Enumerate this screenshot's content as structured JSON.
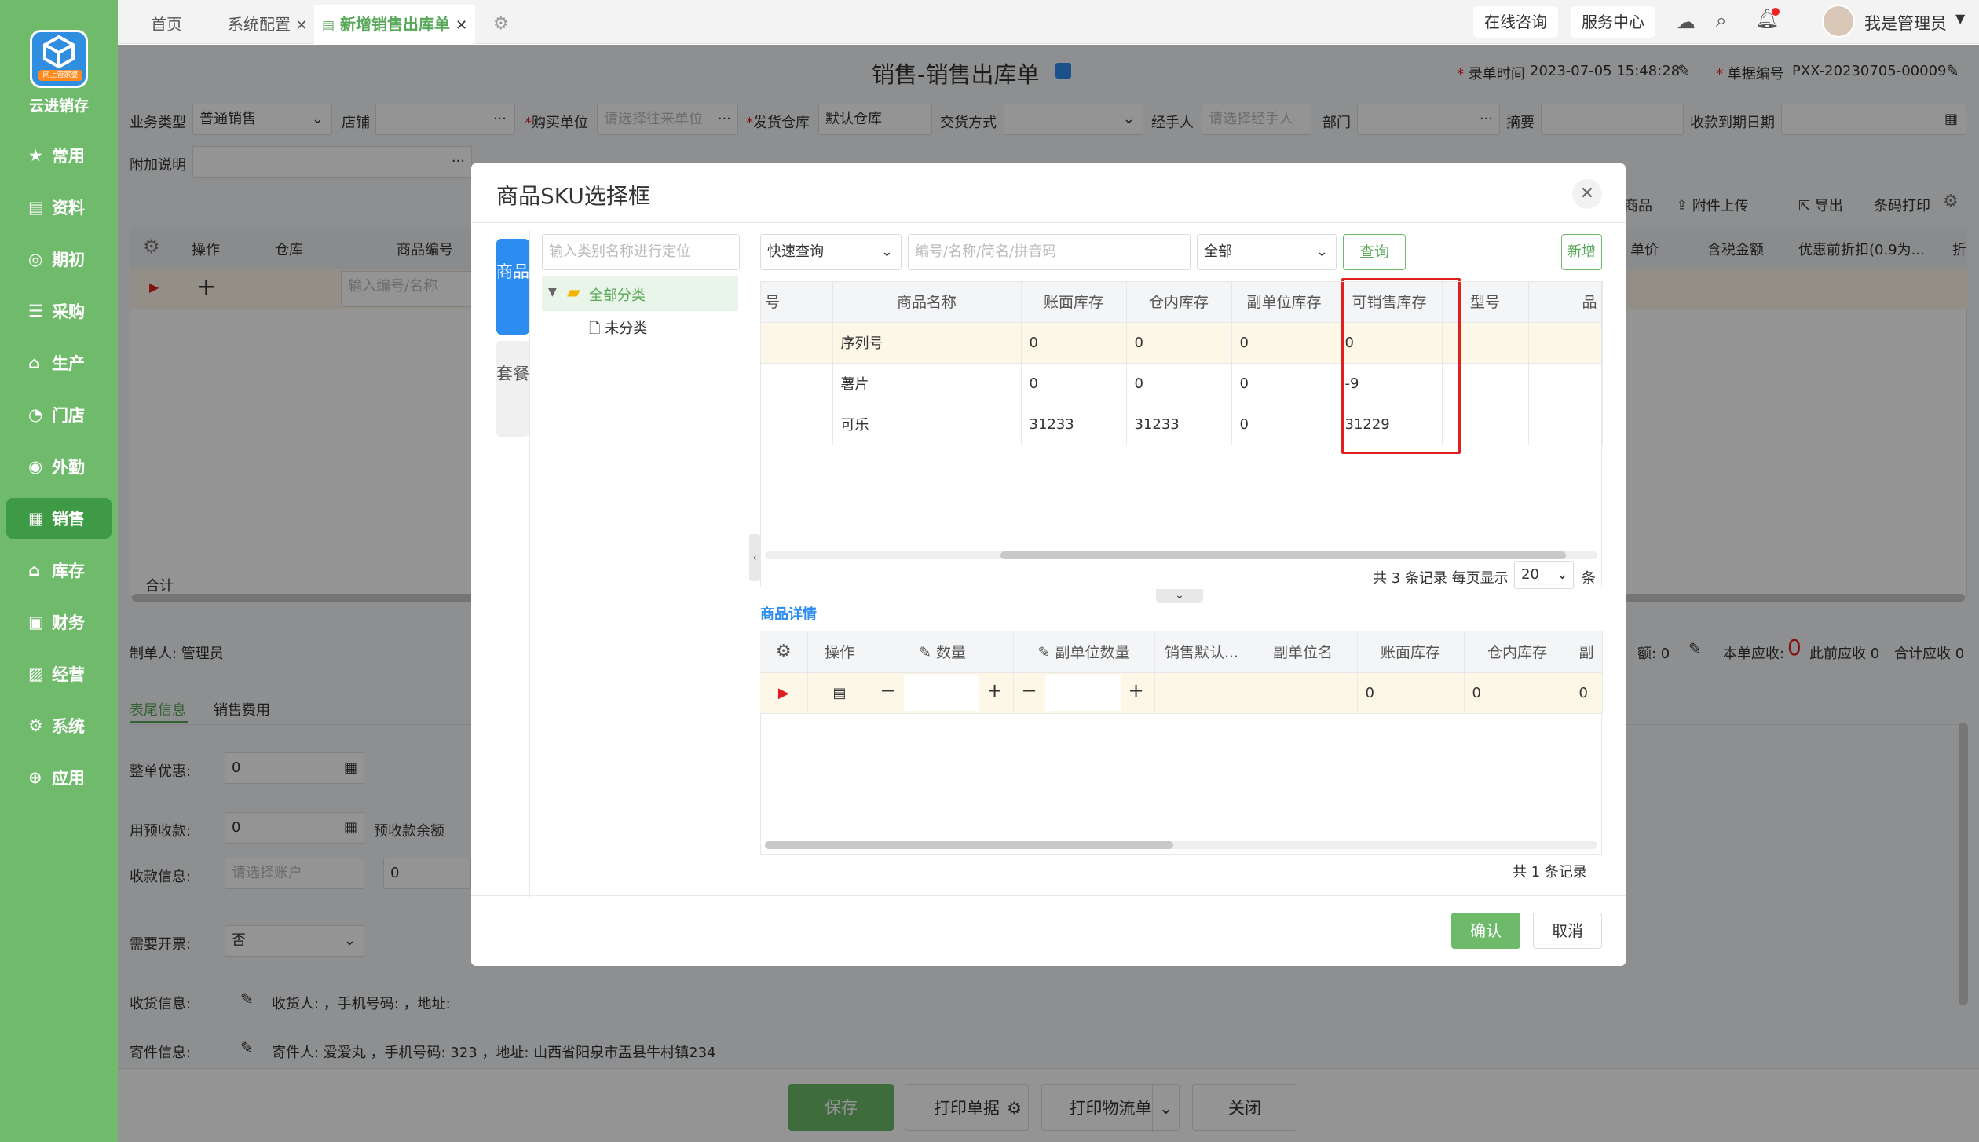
{
  "app": {
    "brand": "云进销存",
    "logo_tag": "网上管家婆"
  },
  "sidebar": {
    "items": [
      {
        "label": "常用",
        "icon": "star-icon"
      },
      {
        "label": "资料",
        "icon": "document-icon"
      },
      {
        "label": "期初",
        "icon": "target-icon"
      },
      {
        "label": "采购",
        "icon": "list-icon"
      },
      {
        "label": "生产",
        "icon": "factory-icon"
      },
      {
        "label": "门店",
        "icon": "pie-icon"
      },
      {
        "label": "外勤",
        "icon": "location-icon"
      },
      {
        "label": "销售",
        "icon": "bar-chart-icon"
      },
      {
        "label": "库存",
        "icon": "warehouse-icon"
      },
      {
        "label": "财务",
        "icon": "wallet-icon"
      },
      {
        "label": "经营",
        "icon": "image-icon"
      },
      {
        "label": "系统",
        "icon": "gear-icon"
      },
      {
        "label": "应用",
        "icon": "plus-icon"
      }
    ],
    "active_index": 7
  },
  "tabs": {
    "items": [
      "首页",
      "系统配置",
      "新增销售出库单"
    ],
    "active_index": 2
  },
  "header": {
    "online_consult": "在线咨询",
    "service_center": "服务中心",
    "user": "我是管理员"
  },
  "doc": {
    "title": "销售-销售出库单",
    "entry_time_label": "录单时间",
    "entry_time": "2023-07-05 15:48:28",
    "doc_no_label": "单据编号",
    "doc_no": "PXX-20230705-00009"
  },
  "form": {
    "biz_type_label": "业务类型",
    "biz_type": "普通销售",
    "shop_label": "店铺",
    "buyer_label": "购买单位",
    "buyer_placeholder": "请选择往来单位",
    "warehouse_label": "发货仓库",
    "warehouse": "默认仓库",
    "trade_label": "交货方式",
    "handler_label": "经手人",
    "handler_placeholder": "请选择经手人",
    "dept_label": "部门",
    "summary_label": "摘要",
    "due_label": "收款到期日期",
    "extra_label": "附加说明"
  },
  "bg_table": {
    "headers": [
      "操作",
      "仓库",
      "商品编号"
    ],
    "right_headers": [
      "商品",
      "附件上传",
      "导出",
      "条码打印"
    ],
    "price_headers": [
      "单价",
      "含税金额",
      "优惠前折扣(0.9为...",
      "折"
    ],
    "input_placeholder": "输入编号/名称",
    "total_label": "合计"
  },
  "bg_bottom": {
    "maker": "制单人: 管理员",
    "tabs": [
      "表尾信息",
      "销售费用"
    ],
    "discount_label": "整单优惠:",
    "discount": "0",
    "prepay_label": "用预收款:",
    "prepay": "0",
    "prepay_balance_label": "预收款余额",
    "receipt_label": "收款信息:",
    "receipt_placeholder": "请选择账户",
    "receipt_amount": "0",
    "invoice_label": "需要开票:",
    "invoice": "否",
    "ship_label": "收货信息:",
    "ship_text": "收货人:    ，手机号码:    ，地址:",
    "send_label": "寄件信息:",
    "send_text": "寄件人: 爱爱丸 ，手机号码: 323 ，地址: 山西省阳泉市盂县牛村镇234",
    "right_summary": {
      "left_val": "0",
      "this_due_label": "本单应收:",
      "this_due": "0",
      "prev_due": "此前应收 0",
      "total_due": "合计应收 0"
    },
    "footer_buttons": [
      "保存",
      "打印单据",
      "打印物流单",
      "关闭"
    ]
  },
  "modal": {
    "title": "商品SKU选择框",
    "side_tabs": [
      "商品",
      "套餐"
    ],
    "tree_search_placeholder": "输入类别名称进行定位",
    "tree": [
      {
        "label": "全部分类",
        "selected": true
      },
      {
        "label": "未分类",
        "selected": false
      }
    ],
    "quick_query": "快速查询",
    "search_placeholder": "编号/名称/简名/拼音码",
    "filter": "全部",
    "query_btn": "查询",
    "new_btn": "新增",
    "columns": [
      "号",
      "商品名称",
      "账面库存",
      "仓内库存",
      "副单位库存",
      "可销售库存",
      "型号",
      "品"
    ],
    "rows": [
      {
        "name": "序列号",
        "book": "0",
        "wh": "0",
        "sub": "0",
        "sellable": "0"
      },
      {
        "name": "薯片",
        "book": "0",
        "wh": "0",
        "sub": "0",
        "sellable": "-9"
      },
      {
        "name": "可乐",
        "book": "31233",
        "wh": "31233",
        "sub": "0",
        "sellable": "31229"
      }
    ],
    "pager": {
      "total_text": "共 3 条记录",
      "per_page_label": "每页显示",
      "per_page": "20",
      "unit": "条"
    },
    "detail_title": "商品详情",
    "detail_columns": [
      "操作",
      "数量",
      "副单位数量",
      "销售默认...",
      "副单位名",
      "账面库存",
      "仓内库存",
      "副"
    ],
    "detail_row": {
      "book": "0",
      "wh": "0",
      "sub": "0"
    },
    "detail_total": "共 1 条记录",
    "confirm": "确认",
    "cancel": "取消"
  },
  "colors": {
    "green": "#6fba6b",
    "active_nav": "#3f9a46",
    "highlight_box": "#e02020",
    "modal_blue": "#2d8cf0"
  }
}
